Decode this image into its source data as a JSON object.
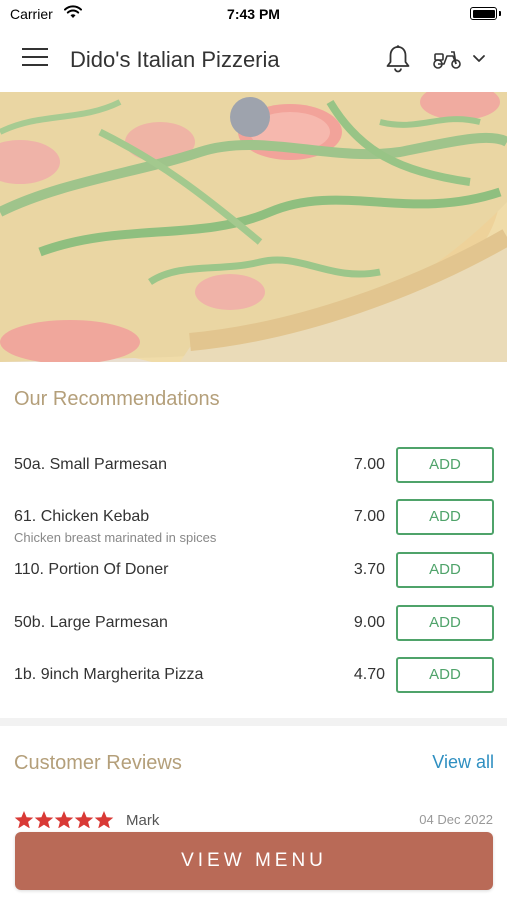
{
  "status_bar": {
    "carrier": "Carrier",
    "time": "7:43 PM"
  },
  "header": {
    "title": "Dido's Italian Pizzeria",
    "icons": [
      "menu-icon",
      "bell-icon",
      "scooter-icon",
      "chevron-down-icon"
    ]
  },
  "recommendations": {
    "title": "Our Recommendations",
    "add_label": "ADD",
    "items": [
      {
        "name": "50a. Small Parmesan",
        "description": "",
        "price": "7.00"
      },
      {
        "name": "61. Chicken Kebab",
        "description": "Chicken breast marinated in spices",
        "price": "7.00"
      },
      {
        "name": "110. Portion Of Doner",
        "description": "",
        "price": "3.70"
      },
      {
        "name": "50b. Large Parmesan",
        "description": "",
        "price": "9.00"
      },
      {
        "name": "1b. 9inch Margherita Pizza",
        "description": "",
        "price": "4.70"
      }
    ]
  },
  "reviews": {
    "title": "Customer Reviews",
    "view_all": "View all",
    "items": [
      {
        "reviewer": "Mark",
        "date": "04 Dec 2022",
        "rating": 5
      }
    ]
  },
  "footer": {
    "view_menu_label": "VIEW MENU"
  },
  "colors": {
    "accent_gold": "#b49f7a",
    "add_green": "#4fa36a",
    "link_blue": "#2e8fc1",
    "cta": "#b96a57",
    "star_red": "#d93a36"
  }
}
